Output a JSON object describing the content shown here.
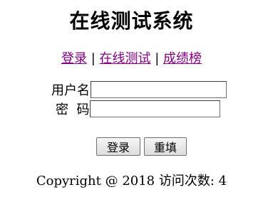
{
  "page": {
    "title": "在线测试系统"
  },
  "nav": {
    "login": "登录",
    "separator": "|",
    "online_test": "在线测试",
    "scores": "成绩榜"
  },
  "form": {
    "username_label": "用户名",
    "username_value": "",
    "password_label": "密  码",
    "password_value": "",
    "login_button": "登录",
    "reset_button": "重填"
  },
  "footer": {
    "text": "Copyright @ 2018 访问次数: 4"
  },
  "colors": {
    "link_visited": "#800080",
    "text": "#000000",
    "background": "#ffffff"
  }
}
